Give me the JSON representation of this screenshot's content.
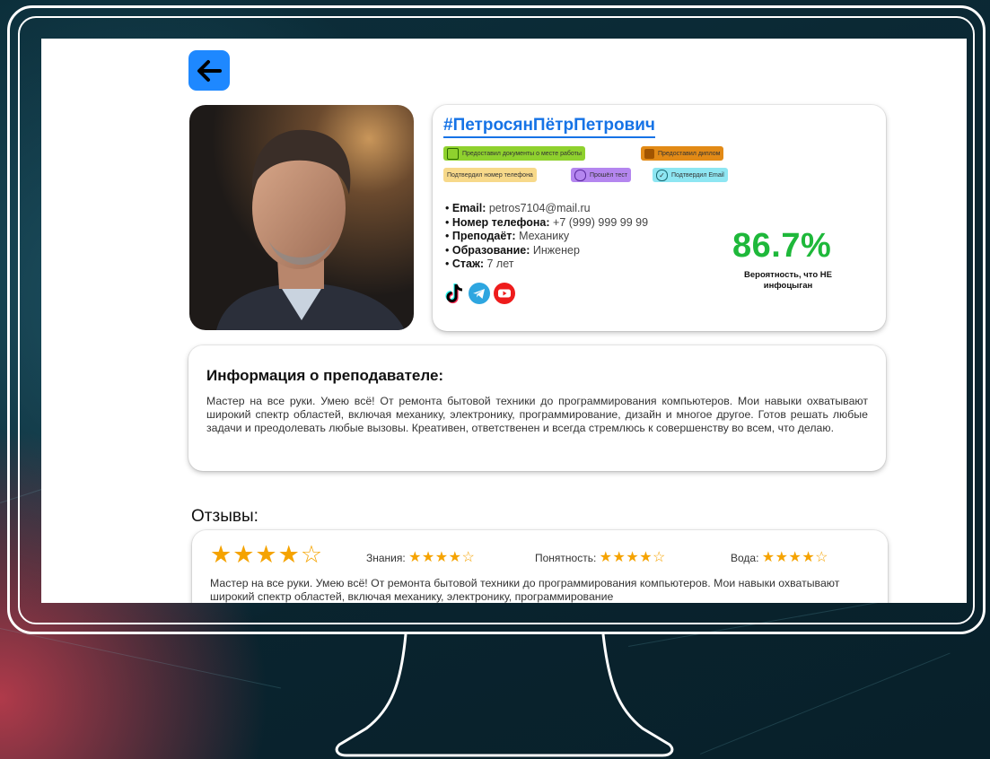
{
  "profile": {
    "name": "#ПетросянПётрПетрович",
    "badges": [
      {
        "label": "Предоставил документы о месте работы",
        "color": "#8fd12e"
      },
      {
        "label": "Предоставил диплом",
        "color": "#e28a16"
      },
      {
        "label": "Подтвердил номер телефона",
        "color": "#f7d98a"
      },
      {
        "label": "Прошёл тест",
        "color": "#b486ef"
      },
      {
        "label": "Подтвердил Email",
        "color": "#8ee6f2"
      }
    ],
    "email_label": "Email:",
    "email_value": "petros7104@mail.ru",
    "phone_label": "Номер телефона:",
    "phone_value": "+7 (999) 999 99 99",
    "teaches_label": "Преподаёт:",
    "teaches_value": "Механику",
    "education_label": "Образование:",
    "education_value": "Инженер",
    "experience_label": "Стаж:",
    "experience_value": "7 лет",
    "probability": "86.7%",
    "probability_label": "Вероятность, что НЕ инфоцыган",
    "socials": [
      "tiktok-icon",
      "telegram-icon",
      "youtube-icon"
    ]
  },
  "about": {
    "title": "Информация о преподавателе:",
    "text": "Мастер на все руки. Умею всё! От ремонта бытовой техники до программирования компьютеров. Мои навыки охватывают широкий спектр областей, включая механику, электронику, программирование, дизайн и многое другое. Готов решать любые задачи и преодолевать любые вызовы. Креативен, ответственен и всегда стремлюсь к совершенству во всем, что делаю."
  },
  "reviews": {
    "title": "Отзывы:",
    "items": [
      {
        "overall_stars": 4,
        "overall_max": 5,
        "knowledge_label": "Знания:",
        "knowledge_stars": 4,
        "clarity_label": "Понятность:",
        "clarity_stars": 4,
        "water_label": "Вода:",
        "water_stars": 4,
        "text": "Мастер на все руки. Умею всё! От ремонта бытовой техники до программирования компьютеров. Мои навыки охватывают широкий спектр областей, включая механику, электронику, программирование"
      }
    ]
  },
  "colors": {
    "accent_blue": "#1673e6",
    "back_button": "#1e88ff",
    "percent_green": "#1eb83a",
    "star": "#f5a300"
  }
}
